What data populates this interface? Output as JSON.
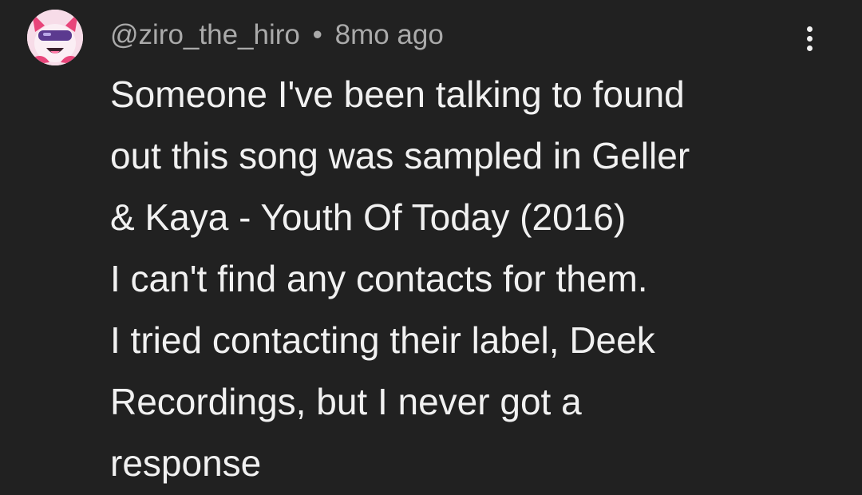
{
  "comment": {
    "author": "@ziro_the_hiro",
    "separator": "•",
    "time": "8mo ago",
    "lines": [
      "Someone I've been talking to found",
      "out this song was sampled in Geller",
      "& Kaya - Youth Of Today (2016)",
      "I can't find any contacts for them.",
      "I tried contacting their label, Deek",
      "Recordings, but I never got a",
      "response"
    ],
    "menu_icon": "more-vertical-icon",
    "avatar_icon": "avatar-icon"
  },
  "colors": {
    "background": "#212121",
    "text": "#f1f1f1",
    "meta": "#aaaaaa",
    "avatar_bg": "#f7dce8",
    "avatar_accent": "#e8457a",
    "avatar_visor": "#5b3a8f"
  }
}
